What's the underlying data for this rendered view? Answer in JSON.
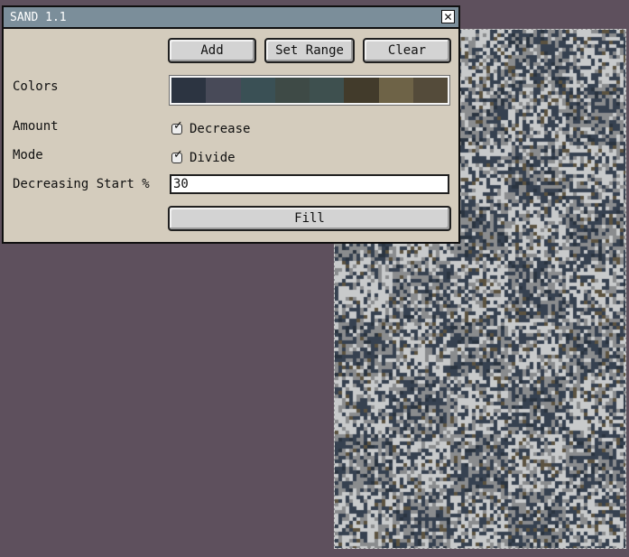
{
  "dialog": {
    "title": "SAND 1.1",
    "close_icon": "close-x-icon",
    "buttons": {
      "add": "Add",
      "set_range": "Set Range",
      "clear": "Clear",
      "fill": "Fill"
    },
    "labels": {
      "colors": "Colors",
      "amount": "Amount",
      "mode": "Mode",
      "decreasing_start": "Decreasing Start %"
    },
    "palette": [
      "#2c3441",
      "#484a58",
      "#3a5055",
      "#3e4a46",
      "#3e504f",
      "#423b2b",
      "#6e6347",
      "#544b3a"
    ],
    "checkboxes": {
      "decrease": {
        "label": "Decrease",
        "checked": true
      },
      "divide": {
        "label": "Divide",
        "checked": true
      }
    },
    "decreasing_start_value": "30"
  },
  "canvas": {
    "colors": {
      "light": "#c8cacb",
      "mid": "#8a8c8e",
      "dark": "#364150",
      "darker": "#2a3440",
      "brown": "#5c5340"
    }
  },
  "colors": {
    "background": "#5e505d",
    "dialog_bg": "#d4ccbd",
    "titlebar": "#7b8e9a"
  }
}
